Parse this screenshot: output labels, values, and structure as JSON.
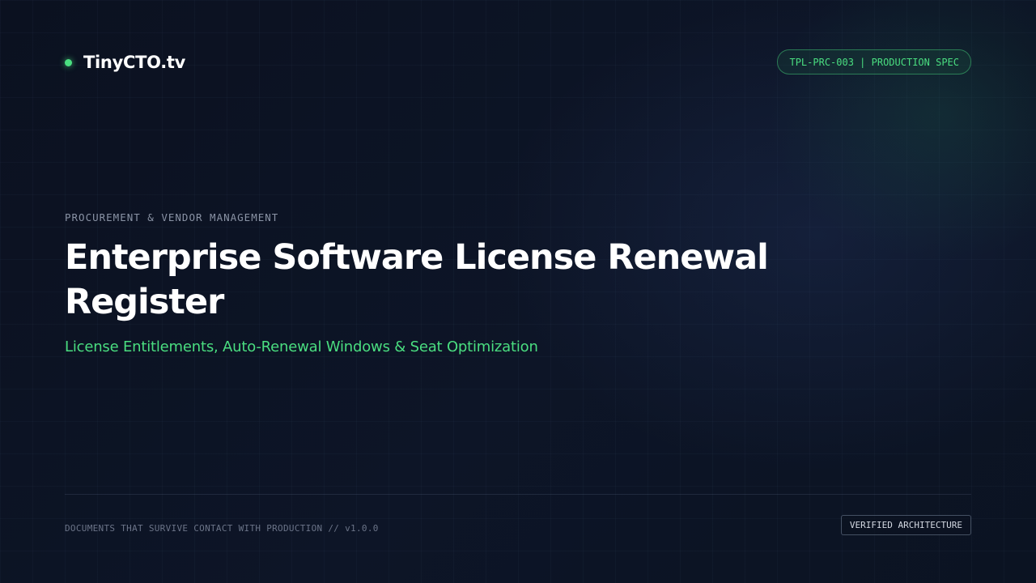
{
  "brand": {
    "name": "TinyCTO.tv",
    "dot_color": "#4ade80"
  },
  "doc_code": "TPL-PRC-003 | PRODUCTION SPEC",
  "category": "PROCUREMENT & VENDOR MANAGEMENT",
  "title": "Enterprise Software License Renewal Register",
  "subtitle": "License Entitlements, Auto-Renewal Windows & Seat Optimization",
  "footer": {
    "tagline": "DOCUMENTS THAT SURVIVE CONTACT WITH PRODUCTION // v1.0.0",
    "badge": "VERIFIED ARCHITECTURE"
  },
  "colors": {
    "accent": "#4ade80",
    "background": "#0c1220",
    "text": "#ffffff",
    "muted": "#8a93a5"
  }
}
